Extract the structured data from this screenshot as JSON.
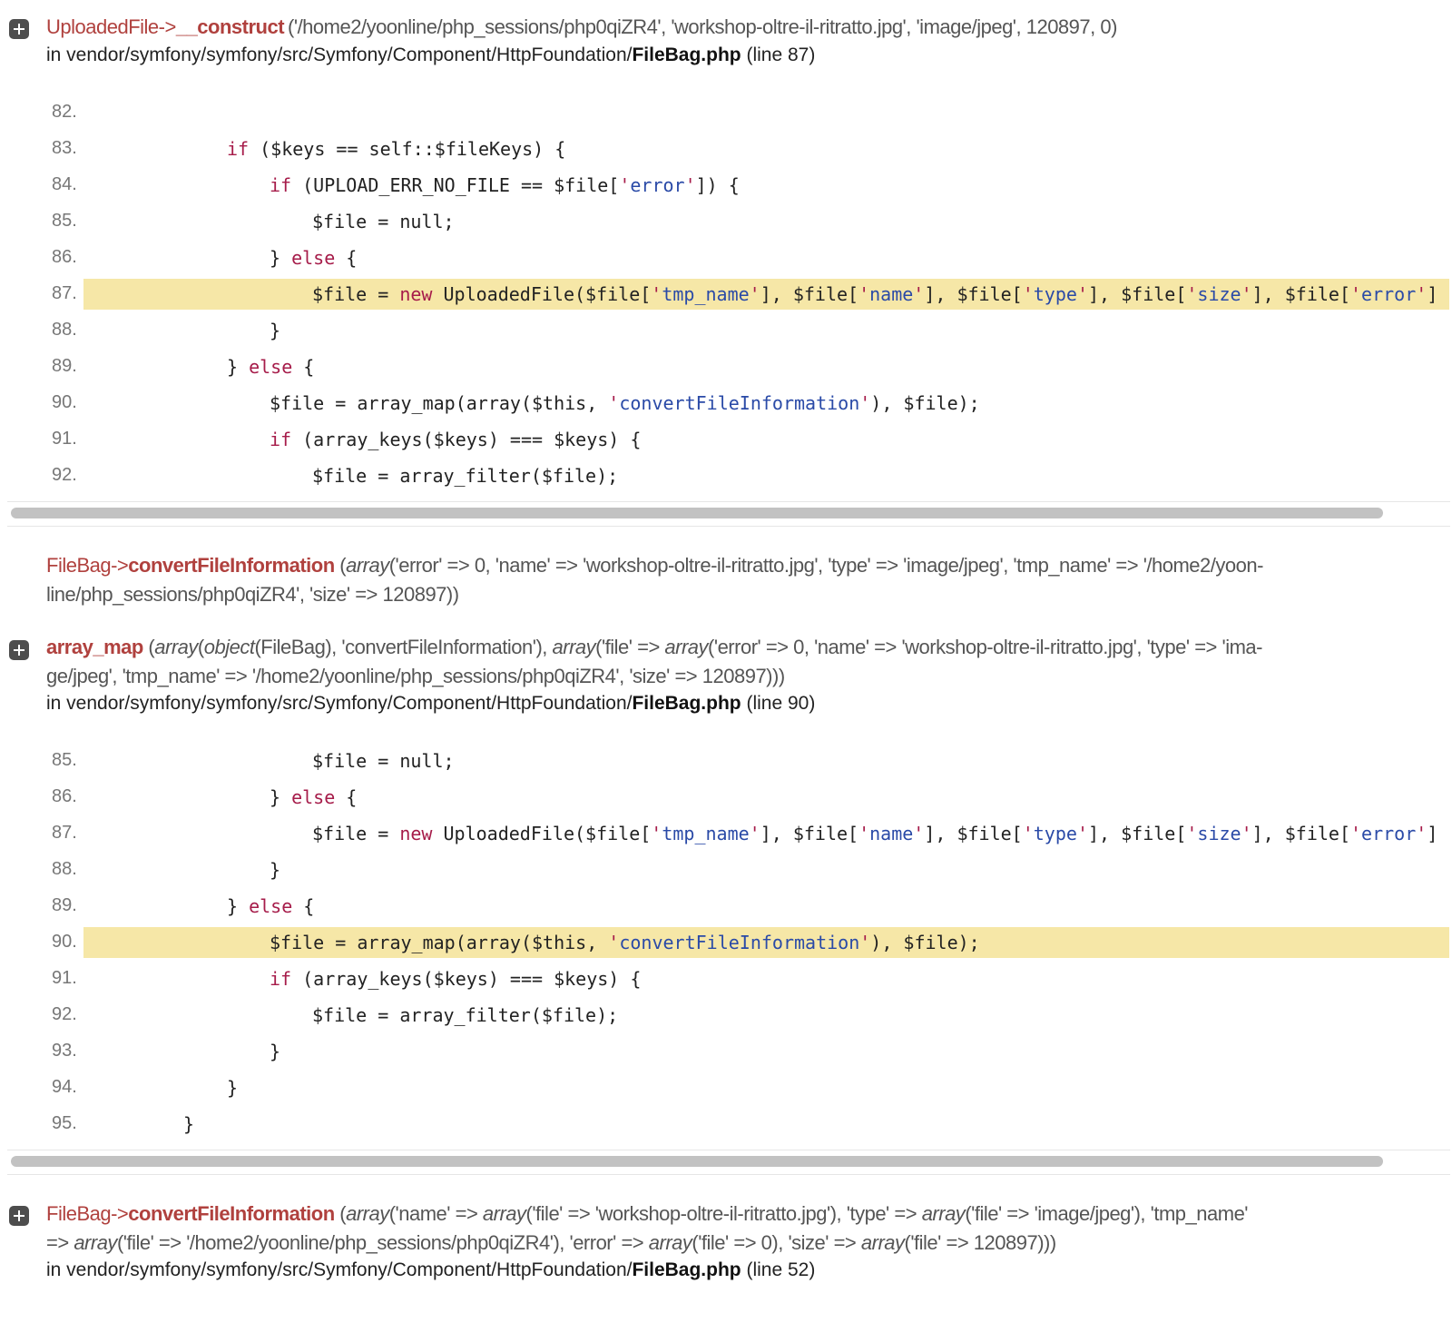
{
  "traces": [
    {
      "class": "UploadedFile",
      "arrow": "->",
      "function": "__construct",
      "args": "('/home2/yoonline/php_sessions/php0qiZR4', 'workshop-oltre-il-ritratto.jpg', 'image/jpeg', 120897, 0)",
      "location_prefix": "in vendor/symfony/symfony/src/Symfony/Component/HttpFoundation/",
      "location_file": "FileBag.php",
      "location_suffix": " (line 87)",
      "code_lines": [
        {
          "num": "82.",
          "code": ""
        },
        {
          "num": "83.",
          "code": "if ($keys == self::$fileKeys) {"
        },
        {
          "num": "84.",
          "code": "if (UPLOAD_ERR_NO_FILE == $file['error']) {"
        },
        {
          "num": "85.",
          "code": "$file = null;"
        },
        {
          "num": "86.",
          "code": "} else {"
        },
        {
          "num": "87.",
          "code": "$file = new UploadedFile($file['tmp_name'], $file['name'], $file['type'], $file['size'], $file['error']"
        },
        {
          "num": "88.",
          "code": "}"
        },
        {
          "num": "89.",
          "code": "} else {"
        },
        {
          "num": "90.",
          "code": "$file = array_map(array($this, 'convertFileInformation'), $file);"
        },
        {
          "num": "91.",
          "code": "if (array_keys($keys) === $keys) {"
        },
        {
          "num": "92.",
          "code": "$file = array_filter($file);"
        }
      ],
      "highlighted_line": "87."
    },
    {
      "class": "FileBag",
      "arrow": "->",
      "function": "convertFileInformation",
      "args_parts": [
        {
          "t": " (",
          "i": false
        },
        {
          "t": "array",
          "i": true
        },
        {
          "t": "('error' => 0, 'name' => 'workshop-oltre-il-ritratto.jpg', 'type' => 'image/jpeg', 'tmp_name' => '/home2/yoon-",
          "i": false
        }
      ],
      "args_line2": "line/php_sessions/php0qiZR4', 'size' => 120897))"
    },
    {
      "class": "",
      "arrow": "",
      "function": "array_map",
      "args_parts": [
        {
          "t": " (",
          "i": false
        },
        {
          "t": "array",
          "i": true
        },
        {
          "t": "(",
          "i": false
        },
        {
          "t": "object",
          "i": true
        },
        {
          "t": "(FileBag), 'convertFileInformation'), ",
          "i": false
        },
        {
          "t": "array",
          "i": true
        },
        {
          "t": "('file' => ",
          "i": false
        },
        {
          "t": "array",
          "i": true
        },
        {
          "t": "('error' => 0, 'name' => 'workshop-oltre-il-ritratto.jpg', 'type' => 'ima-",
          "i": false
        }
      ],
      "args_line2": "ge/jpeg', 'tmp_name' => '/home2/yoonline/php_sessions/php0qiZR4', 'size' => 120897)))",
      "location_prefix": "in vendor/symfony/symfony/src/Symfony/Component/HttpFoundation/",
      "location_file": "FileBag.php",
      "location_suffix": " (line 90)",
      "code_lines": [
        {
          "num": "85.",
          "code": "$file = null;"
        },
        {
          "num": "86.",
          "code": "} else {"
        },
        {
          "num": "87.",
          "code": "$file = new UploadedFile($file['tmp_name'], $file['name'], $file['type'], $file['size'], $file['error']"
        },
        {
          "num": "88.",
          "code": "}"
        },
        {
          "num": "89.",
          "code": "} else {"
        },
        {
          "num": "90.",
          "code": "$file = array_map(array($this, 'convertFileInformation'), $file);"
        },
        {
          "num": "91.",
          "code": "if (array_keys($keys) === $keys) {"
        },
        {
          "num": "92.",
          "code": "$file = array_filter($file);"
        },
        {
          "num": "93.",
          "code": "}"
        },
        {
          "num": "94.",
          "code": "}"
        },
        {
          "num": "95.",
          "code": "}"
        }
      ],
      "highlighted_line": "90."
    },
    {
      "class": "FileBag",
      "arrow": "->",
      "function": "convertFileInformation",
      "args_parts": [
        {
          "t": " (",
          "i": false
        },
        {
          "t": "array",
          "i": true
        },
        {
          "t": "('name' => ",
          "i": false
        },
        {
          "t": "array",
          "i": true
        },
        {
          "t": "('file' => 'workshop-oltre-il-ritratto.jpg'), 'type' => ",
          "i": false
        },
        {
          "t": "array",
          "i": true
        },
        {
          "t": "('file' => 'image/jpeg'), 'tmp_name'",
          "i": false
        }
      ],
      "args_line2_parts": [
        {
          "t": "=> ",
          "i": false
        },
        {
          "t": "array",
          "i": true
        },
        {
          "t": "('file' => '/home2/yoonline/php_sessions/php0qiZR4'), 'error' => ",
          "i": false
        },
        {
          "t": "array",
          "i": true
        },
        {
          "t": "('file' => 0), 'size' => ",
          "i": false
        },
        {
          "t": "array",
          "i": true
        },
        {
          "t": "('file' => 120897)))",
          "i": false
        }
      ],
      "location_prefix": "in vendor/symfony/symfony/src/Symfony/Component/HttpFoundation/",
      "location_file": "FileBag.php",
      "location_suffix": " (line 52)"
    }
  ]
}
